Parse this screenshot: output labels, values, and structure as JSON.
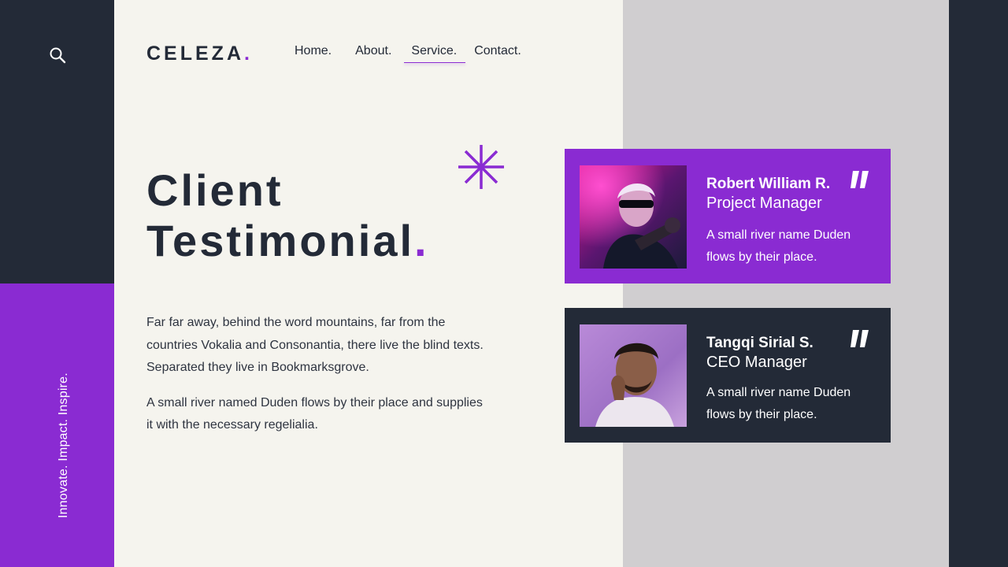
{
  "brand": {
    "logo_text": "CELEZA",
    "logo_dot": "."
  },
  "nav": {
    "items": [
      {
        "label": "Home."
      },
      {
        "label": "About."
      },
      {
        "label": "Service.",
        "active": true
      },
      {
        "label": "Contact."
      }
    ]
  },
  "search": {
    "icon": "search-icon"
  },
  "sidebar": {
    "tagline": "Innovate. Impact. Inspire."
  },
  "hero": {
    "title_line1": "Client",
    "title_line2": "Testimonial",
    "title_dot": ".",
    "paragraphs": [
      "Far far away, behind the word mountains, far from the countries Vokalia and Consonantia, there live the blind texts. Separated they live in Bookmarksgrove.",
      "A small river named Duden flows by their place and supplies it with the necessary regelialia."
    ]
  },
  "testimonials": [
    {
      "name": "Robert William R.",
      "role": "Project Manager",
      "quote": "A small river name Duden flows by their place.",
      "icon": "quote-icon"
    },
    {
      "name": "Tangqi Sirial S.",
      "role": "CEO Manager",
      "quote": "A small river name Duden flows by their place.",
      "icon": "quote-icon"
    }
  ],
  "colors": {
    "accent": "#8A2BD2",
    "dark": "#232A37",
    "background": "#F5F4EE",
    "panel_gray": "#D0CED0"
  }
}
